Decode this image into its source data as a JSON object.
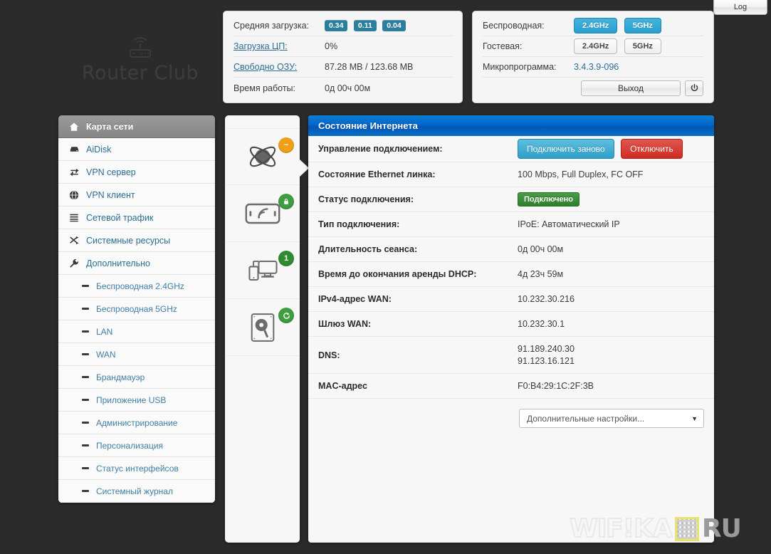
{
  "topbar": {
    "log_label": "Log"
  },
  "logo": {
    "text": "Router Club",
    "icon": "router-wifi-icon"
  },
  "system_card": {
    "rows": [
      {
        "label": "Средняя загрузка:",
        "type": "badges",
        "values": [
          "0.34",
          "0.11",
          "0.04"
        ]
      },
      {
        "label": "Загрузка ЦП:",
        "type": "text",
        "value": "0%",
        "label_link": true
      },
      {
        "label": "Свободно ОЗУ:",
        "type": "text",
        "value": "87.28 MB / 123.68 MB",
        "label_link": true
      },
      {
        "label": "Время работы:",
        "type": "text",
        "value": "0д 00ч 00м",
        "label_link": false
      }
    ]
  },
  "wireless_card": {
    "wireless_label": "Беспроводная:",
    "wireless_buttons": [
      {
        "label": "2.4GHz",
        "state": "on"
      },
      {
        "label": "5GHz",
        "state": "on"
      }
    ],
    "guest_label": "Гостевая:",
    "guest_buttons": [
      {
        "label": "2.4GHz",
        "state": "off"
      },
      {
        "label": "5GHz",
        "state": "off"
      }
    ],
    "firmware_label": "Микропрограмма:",
    "firmware_value": "3.4.3.9-096",
    "logout_label": "Выход",
    "power_icon": "power-icon"
  },
  "sidebar": {
    "items": [
      {
        "label": "Карта сети",
        "icon": "home-icon",
        "active": true,
        "sub": false
      },
      {
        "label": "AiDisk",
        "icon": "harddrive-icon",
        "active": false,
        "sub": false
      },
      {
        "label": "VPN сервер",
        "icon": "exchange-icon",
        "active": false,
        "sub": false
      },
      {
        "label": "VPN клиент",
        "icon": "globe-icon",
        "active": false,
        "sub": false
      },
      {
        "label": "Сетевой трафик",
        "icon": "list-icon",
        "active": false,
        "sub": false
      },
      {
        "label": "Системные ресурсы",
        "icon": "shuffle-icon",
        "active": false,
        "sub": false
      },
      {
        "label": "Дополнительно",
        "icon": "wrench-icon",
        "active": false,
        "sub": false
      },
      {
        "label": "Беспроводная 2.4GHz",
        "icon": "dash-icon",
        "active": false,
        "sub": true
      },
      {
        "label": "Беспроводная 5GHz",
        "icon": "dash-icon",
        "active": false,
        "sub": true
      },
      {
        "label": "LAN",
        "icon": "dash-icon",
        "active": false,
        "sub": true
      },
      {
        "label": "WAN",
        "icon": "dash-icon",
        "active": false,
        "sub": true
      },
      {
        "label": "Брандмауэр",
        "icon": "dash-icon",
        "active": false,
        "sub": true
      },
      {
        "label": "Приложение USB",
        "icon": "dash-icon",
        "active": false,
        "sub": true
      },
      {
        "label": "Администрирование",
        "icon": "dash-icon",
        "active": false,
        "sub": true
      },
      {
        "label": "Персонализация",
        "icon": "dash-icon",
        "active": false,
        "sub": true
      },
      {
        "label": "Статус интерфейсов",
        "icon": "dash-icon",
        "active": false,
        "sub": true
      },
      {
        "label": "Системный журнал",
        "icon": "dash-icon",
        "active": false,
        "sub": true
      }
    ]
  },
  "device_column": {
    "cells": [
      {
        "icon": "internet-globe-icon",
        "badge": "−",
        "badge_color": "orange"
      },
      {
        "icon": "wireless-device-icon",
        "badge": "lock",
        "badge_color": "green"
      },
      {
        "icon": "clients-icon",
        "badge": "1",
        "badge_color": "green-d"
      },
      {
        "icon": "usb-disk-icon",
        "badge": "eject",
        "badge_color": "green"
      }
    ]
  },
  "main_panel": {
    "title": "Состояние Интернета",
    "rows": [
      {
        "label": "Управление подключением:",
        "type": "buttons",
        "buttons": [
          {
            "label": "Подключить заново",
            "style": "blue"
          },
          {
            "label": "Отключить",
            "style": "red"
          }
        ]
      },
      {
        "label": "Состояние Ethernet линка:",
        "type": "text",
        "value": "100 Mbps, Full Duplex, FC OFF"
      },
      {
        "label": "Статус подключения:",
        "type": "badge",
        "value": "Подключено"
      },
      {
        "label": "Тип подключения:",
        "type": "text",
        "value": "IPoE: Автоматический IP"
      },
      {
        "label": "Длительность сеанса:",
        "type": "text",
        "value": "0д 00ч 00м"
      },
      {
        "label": "Время до окончания аренды DHCP:",
        "type": "text",
        "value": "4д 23ч 59м"
      },
      {
        "label": "IPv4-адрес WAN:",
        "type": "text",
        "value": "10.232.30.216"
      },
      {
        "label": "Шлюз WAN:",
        "type": "text",
        "value": "10.232.30.1"
      },
      {
        "label": "DNS:",
        "type": "multiline",
        "value": "91.189.240.30\n91.123.16.121"
      },
      {
        "label": "MAC-адрес",
        "type": "text",
        "value": "F0:B4:29:1C:2F:3B"
      }
    ],
    "select": {
      "value": "Дополнительные настройки...",
      "caret": "▼"
    }
  },
  "watermark": {
    "part1": "WIF!KA",
    "qr": "qr-code-icon",
    "part2": "RU"
  },
  "colors": {
    "background": "#2b2b2b",
    "panel_header_blue": "#0066cc",
    "accent_teal": "#2c7f9c",
    "link_blue": "#2b6d93",
    "status_green": "#2f7f2c",
    "danger_red": "#cf2b22",
    "badge_orange": "#f0a017"
  }
}
